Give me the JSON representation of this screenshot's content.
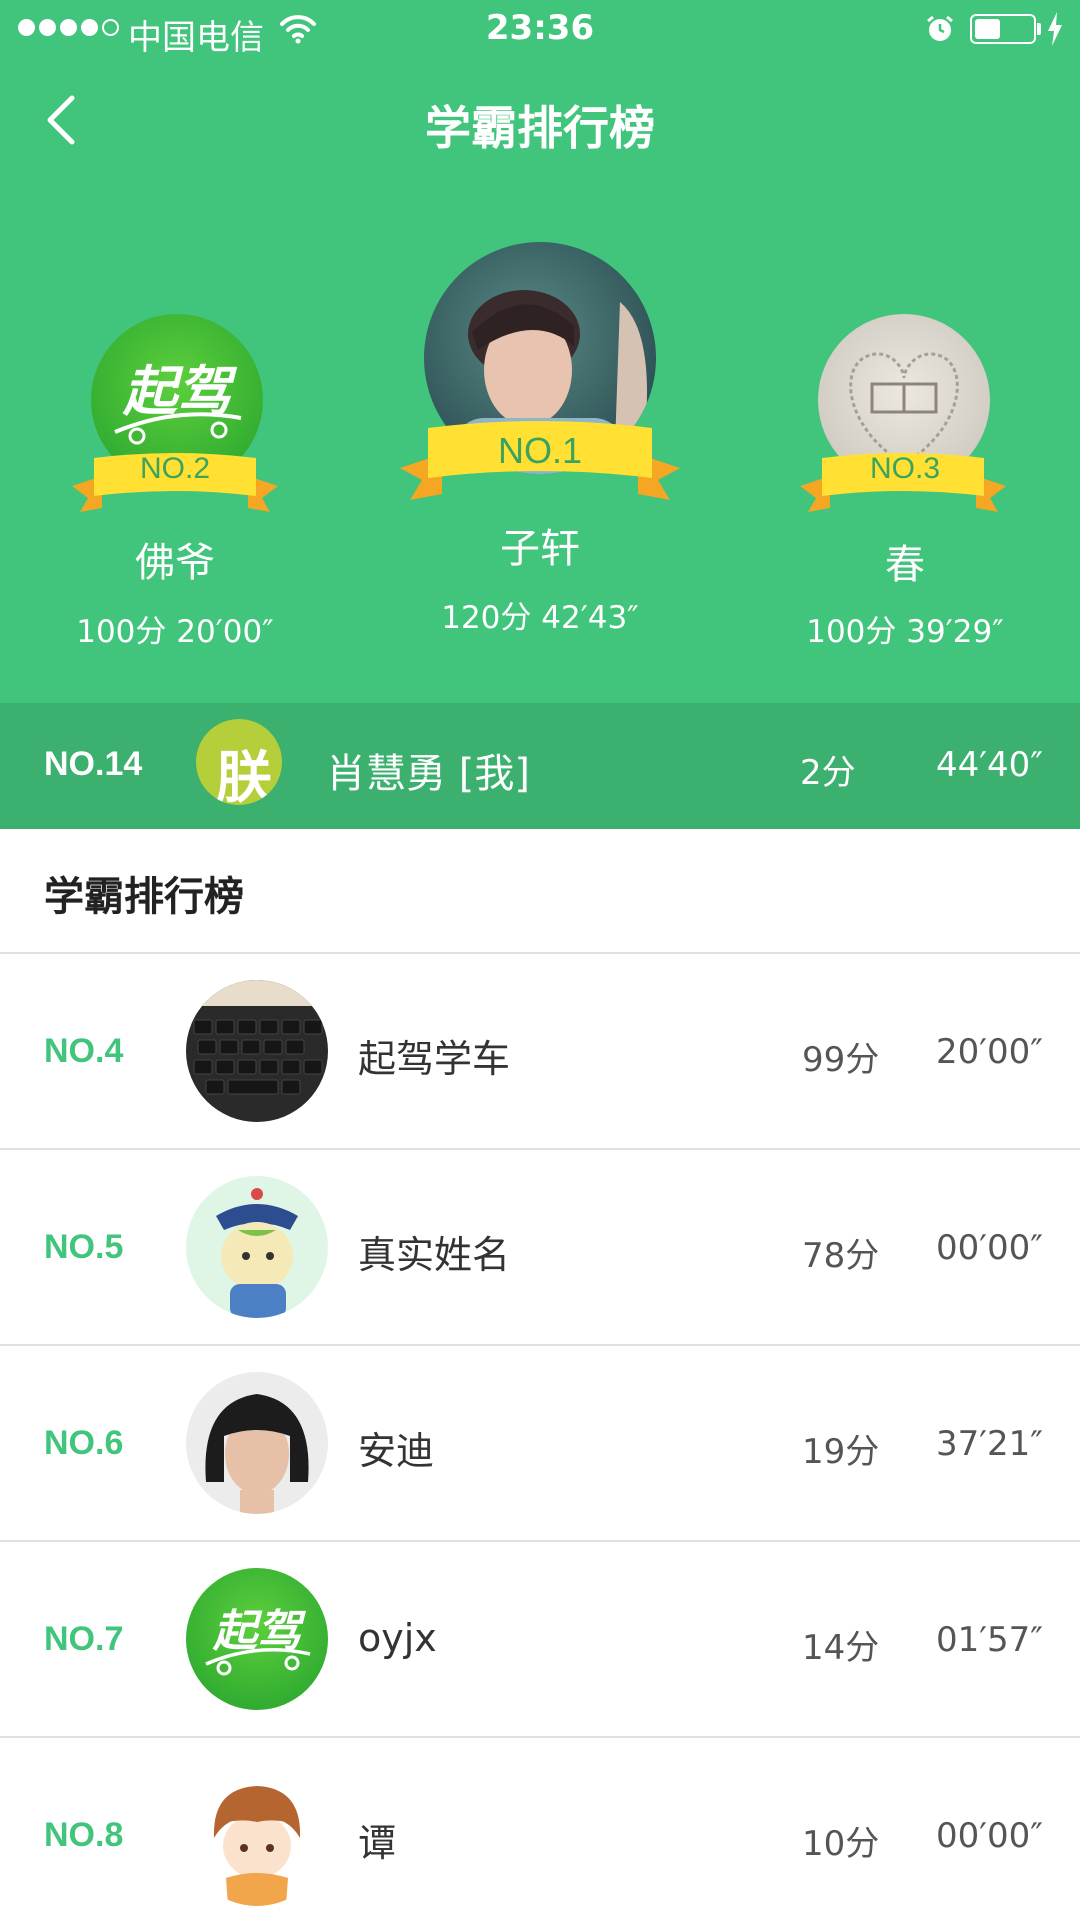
{
  "status_bar": {
    "carrier": "中国电信",
    "time": "23:36",
    "battery_level": 0.45
  },
  "nav": {
    "title": "学霸排行榜"
  },
  "podium": {
    "first": {
      "rank": "NO.1",
      "name": "子轩",
      "stats": "120分  42′43″"
    },
    "second": {
      "rank": "NO.2",
      "name": "佛爷",
      "stats": "100分  20′00″",
      "avatar_logo_text": "起驾"
    },
    "third": {
      "rank": "NO.3",
      "name": "春",
      "stats": "100分  39′29″"
    }
  },
  "me": {
    "rank": "NO.14",
    "avatar_char": "朕",
    "name": "肖慧勇  [我]",
    "score": "2分",
    "time": "44′40″"
  },
  "list": {
    "title": "学霸排行榜",
    "rows": [
      {
        "rank": "NO.4",
        "name": "起驾学车",
        "score": "99分",
        "time": "20′00″"
      },
      {
        "rank": "NO.5",
        "name": "真实姓名",
        "score": "78分",
        "time": "00′00″"
      },
      {
        "rank": "NO.6",
        "name": "安迪",
        "score": "19分",
        "time": "37′21″"
      },
      {
        "rank": "NO.7",
        "name": "oyjx",
        "score": "14分",
        "time": "01′57″",
        "avatar_logo_text": "起驾"
      },
      {
        "rank": "NO.8",
        "name": "谭",
        "score": "10分",
        "time": "00′00″"
      }
    ]
  },
  "colors": {
    "brand_green": "#41c47b",
    "me_bar_green": "#3bb06f",
    "ribbon_yellow": "#ffe033",
    "ribbon_orange": "#f5a623"
  }
}
